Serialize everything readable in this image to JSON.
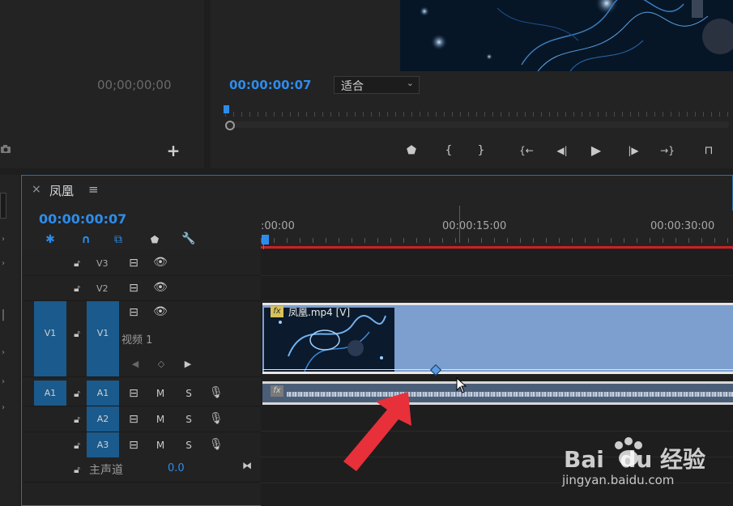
{
  "source_monitor": {
    "timecode": "00;00;00;00",
    "camera_icon": "camera-icon",
    "add_icon": "plus-icon"
  },
  "program_monitor": {
    "timecode": "00:00:00:07",
    "fit_select": "适合",
    "controls": [
      {
        "name": "add-marker-button",
        "glyph": "⬟"
      },
      {
        "name": "mark-in-button",
        "glyph": "{"
      },
      {
        "name": "mark-out-button",
        "glyph": "}"
      },
      {
        "name": "go-to-in-button",
        "glyph": "{←"
      },
      {
        "name": "step-back-button",
        "glyph": "◀|"
      },
      {
        "name": "play-button",
        "glyph": "▶"
      },
      {
        "name": "step-forward-button",
        "glyph": "|▶"
      },
      {
        "name": "go-to-out-button",
        "glyph": "→}"
      },
      {
        "name": "lift-button",
        "glyph": "⊓"
      }
    ]
  },
  "timeline": {
    "close": "×",
    "sequence_name": "凤凰",
    "menu": "≡",
    "timecode": "00:00:00:07",
    "ruler_labels": [
      ":00:00",
      "00:00:15:00",
      "00:00:30:00"
    ],
    "tracks": {
      "v3": "V3",
      "v2": "V2",
      "v1_source": "V1",
      "v1": "V1",
      "v1_name": "视频 1",
      "a1_source": "A1",
      "a1": "A1",
      "a2": "A2",
      "a3": "A3",
      "mute": "M",
      "solo": "S",
      "master": "主声道",
      "master_value": "0.0"
    },
    "clip": {
      "fx": "fx",
      "name": "凤凰.mp4 [V]"
    },
    "audio_fx": "fx"
  },
  "watermark": {
    "brand": "Bai  du 经验",
    "url": "jingyan.baidu.com"
  },
  "colors": {
    "accent": "#2d8ceb",
    "clip_video": "#7d9fd0",
    "clip_audio": "#b8c4d6",
    "track_target": "#1a5a8c",
    "arrow": "#e8303a",
    "work_area": "#d02020"
  }
}
